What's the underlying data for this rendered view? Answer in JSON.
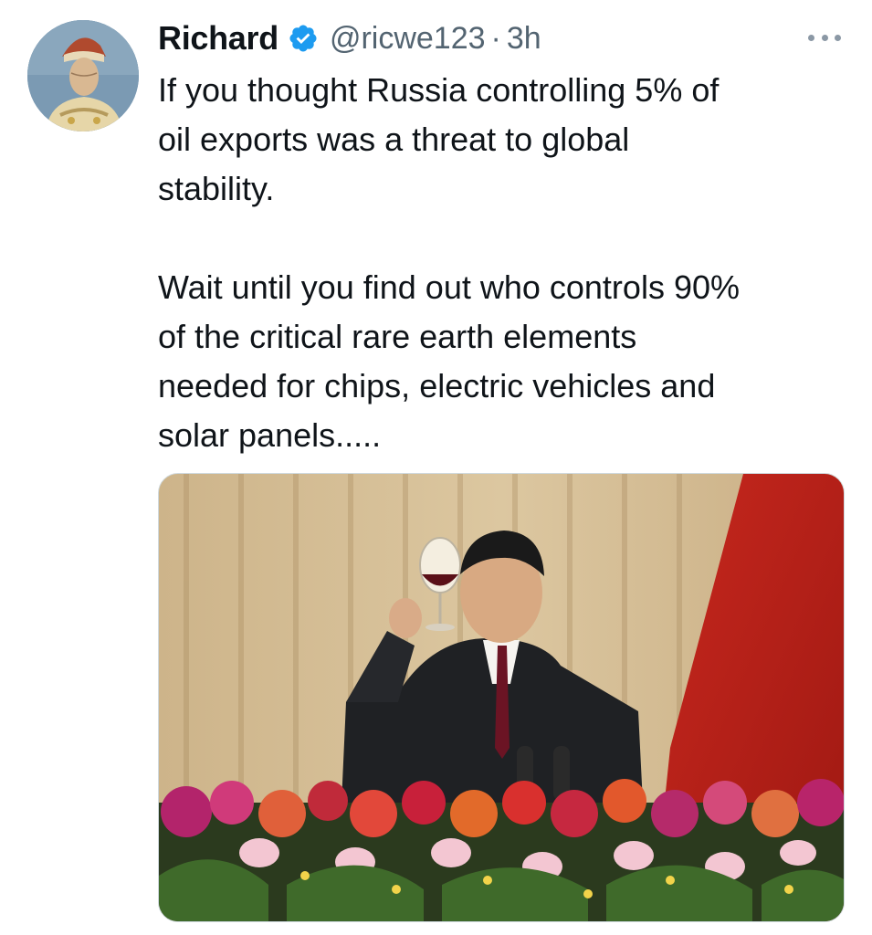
{
  "author": {
    "display_name": "Richard",
    "verified": true,
    "handle": "@ricwe123",
    "separator": "·",
    "timestamp": "3h"
  },
  "tweet": {
    "paragraphs": [
      [
        "If you thought Russia controlling 5% of",
        "oil exports was a threat to global",
        "stability."
      ],
      [
        "Wait until you find out who controls 90%",
        "of the critical rare earth elements",
        "needed for chips, electric vehicles and",
        "solar panels....."
      ]
    ]
  },
  "icons": {
    "avatar": "portrait-avatar",
    "verified": "verified-badge-icon",
    "more": "more-options-icon"
  },
  "colors": {
    "text_primary": "#0f1419",
    "text_secondary": "#536471",
    "verified_blue": "#1d9bf0"
  }
}
